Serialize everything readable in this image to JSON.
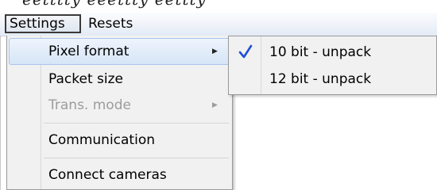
{
  "top_fragment": "eetttty eeettty eettty",
  "menubar": {
    "items": [
      {
        "label": "Settings"
      },
      {
        "label": "Resets"
      }
    ]
  },
  "settings_menu": {
    "items": [
      {
        "label": "Pixel format",
        "has_submenu": true,
        "enabled": true,
        "highlighted": true
      },
      {
        "label": "Packet size",
        "has_submenu": false,
        "enabled": true
      },
      {
        "label": "Trans. mode",
        "has_submenu": true,
        "enabled": false
      },
      {
        "label": "Communication",
        "has_submenu": false,
        "enabled": true
      },
      {
        "label": "Connect cameras",
        "has_submenu": false,
        "enabled": true
      }
    ]
  },
  "pixel_format_submenu": {
    "items": [
      {
        "label": "10 bit - unpack",
        "checked": true
      },
      {
        "label": "12 bit - unpack",
        "checked": false
      }
    ]
  },
  "colors": {
    "menubar_bg": "#e4ebf5",
    "menu_bg": "#f1f1f1",
    "highlight": "#d6e5f7",
    "highlight_border": "#a9c6ec",
    "disabled_text": "#9c9c9c",
    "check_blue": "#1f4fd8"
  },
  "icons": {
    "check": "check-icon",
    "submenu_arrow": "triangle-right-icon"
  }
}
